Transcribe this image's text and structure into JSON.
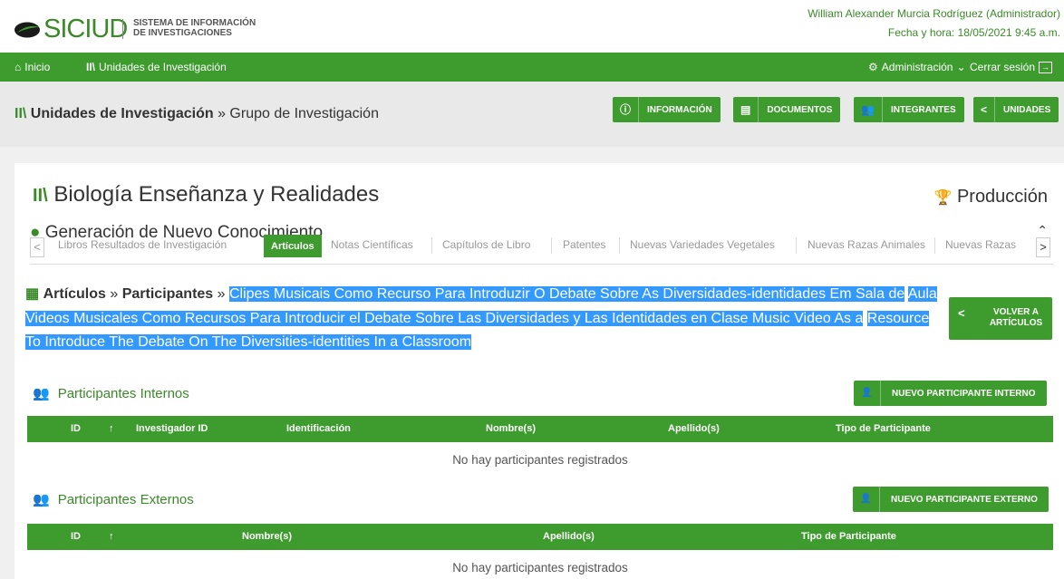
{
  "header": {
    "logo_text": "SICIUD",
    "logo_sub_line1": "SISTEMA DE INFORMACIÓN",
    "logo_sub_line2": "DE INVESTIGACIONES",
    "user": "William Alexander Murcia Rodríguez (Administrador)",
    "datetime": "Fecha y hora: 18/05/2021 9:45 a.m."
  },
  "nav": {
    "home": "Inicio",
    "units": "Unidades de Investigación",
    "admin": "Administración",
    "logout": "Cerrar sesión"
  },
  "breadcrumb": {
    "section": "Unidades de Investigación",
    "separator": " » ",
    "current": "Grupo de Investigación"
  },
  "toolbar": {
    "info": "INFORMACIÓN",
    "docs": "DOCUMENTOS",
    "members": "INTEGRANTES",
    "units": "UNIDADES"
  },
  "group": {
    "title": "Biología Enseñanza y Realidades",
    "production": "Producción",
    "category": "Generación de Nuevo Conocimiento"
  },
  "tabs": [
    "Libros Resultados de Investigación",
    "Artículos",
    "Notas Científicas",
    "Capítulos de Libro",
    "Patentes",
    "Nuevas Variedades Vegetales",
    "Nuevas Razas Animales",
    "Nuevas Razas"
  ],
  "article": {
    "crumb_articles": "Artículos",
    "crumb_sep1": " » ",
    "crumb_participants": "Participantes",
    "crumb_sep2": " » ",
    "title_line1": "Clipes Musicais Como Recurso Para Introduzir O Debate Sobre As Diversidades-identidades Em Sala de",
    "title_line2": "Aula Videos Musicales Como Recursos Para Introducir el Debate Sobre Las Diversidades y Las Identidades en Clase Music Video As a",
    "title_line3": "Resource To Introduce The Debate On The Diversities-identities In a Classroom",
    "back_line1": "VOLVER A",
    "back_line2": "ARTÍCULOS"
  },
  "internal": {
    "heading": "Participantes Internos",
    "button": "NUEVO PARTICIPANTE INTERNO",
    "columns": [
      "ID",
      "Investigador ID",
      "Identificación",
      "Nombre(s)",
      "Apellido(s)",
      "Tipo de Participante"
    ],
    "empty": "No hay participantes registrados"
  },
  "external": {
    "heading": "Participantes Externos",
    "button": "NUEVO PARTICIPANTE EXTERNO",
    "columns": [
      "ID",
      "Nombre(s)",
      "Apellido(s)",
      "Tipo de Participante"
    ],
    "empty": "No hay participantes registrados"
  },
  "colors": {
    "primary_green": "#3e9b2e",
    "text_green": "#3a8a28",
    "highlight": "#3399ff"
  }
}
